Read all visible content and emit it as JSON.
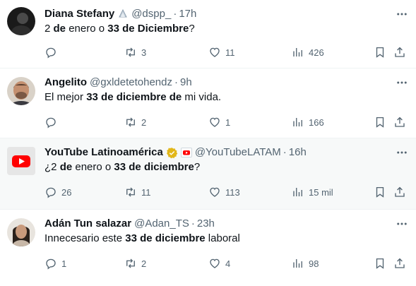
{
  "tweets": [
    {
      "name": "Diana Stefany",
      "handle": "@dspp_",
      "dot": "·",
      "time": "17h",
      "text": [
        {
          "t": "2 ",
          "b": false
        },
        {
          "t": "de",
          "b": true
        },
        {
          "t": " enero o ",
          "b": false
        },
        {
          "t": "33 de Diciembre",
          "b": true
        },
        {
          "t": "?",
          "b": false
        }
      ],
      "replies": "",
      "retweets": "3",
      "likes": "11",
      "views": "426"
    },
    {
      "name": "Angelito",
      "handle": "@gxldetetohendz",
      "dot": "·",
      "time": "9h",
      "text": [
        {
          "t": "El mejor ",
          "b": false
        },
        {
          "t": "33 de diciembre de",
          "b": true
        },
        {
          "t": " mi vida.",
          "b": false
        }
      ],
      "replies": "",
      "retweets": "2",
      "likes": "1",
      "views": "166"
    },
    {
      "name": "YouTube Latinoamérica",
      "handle": "@YouTubeLATAM",
      "dot": "·",
      "time": "16h",
      "text": [
        {
          "t": "¿2 ",
          "b": false
        },
        {
          "t": "de",
          "b": true
        },
        {
          "t": " enero o ",
          "b": false
        },
        {
          "t": "33 de diciembre",
          "b": true
        },
        {
          "t": "?",
          "b": false
        }
      ],
      "replies": "26",
      "retweets": "11",
      "likes": "113",
      "views": "15 mil"
    },
    {
      "name": "Adán Tun salazar",
      "handle": "@Adan_TS",
      "dot": "·",
      "time": "23h",
      "text": [
        {
          "t": "Innecesario este ",
          "b": false
        },
        {
          "t": "33 de diciembre",
          "b": true
        },
        {
          "t": " laboral",
          "b": false
        }
      ],
      "replies": "1",
      "retweets": "2",
      "likes": "4",
      "views": "98"
    }
  ],
  "colors": {
    "text": "#0f1419",
    "secondary": "#536471",
    "divider": "#eff3f4",
    "highlight": "#f7f9f9",
    "verified_gold": "#e2b719",
    "youtube_red": "#ff0000"
  },
  "icons": [
    "reply-icon",
    "retweet-icon",
    "like-icon",
    "views-icon",
    "bookmark-icon",
    "share-icon",
    "more-icon",
    "verified-badge-icon",
    "youtube-logo-icon",
    "emoji-badge-icon"
  ]
}
